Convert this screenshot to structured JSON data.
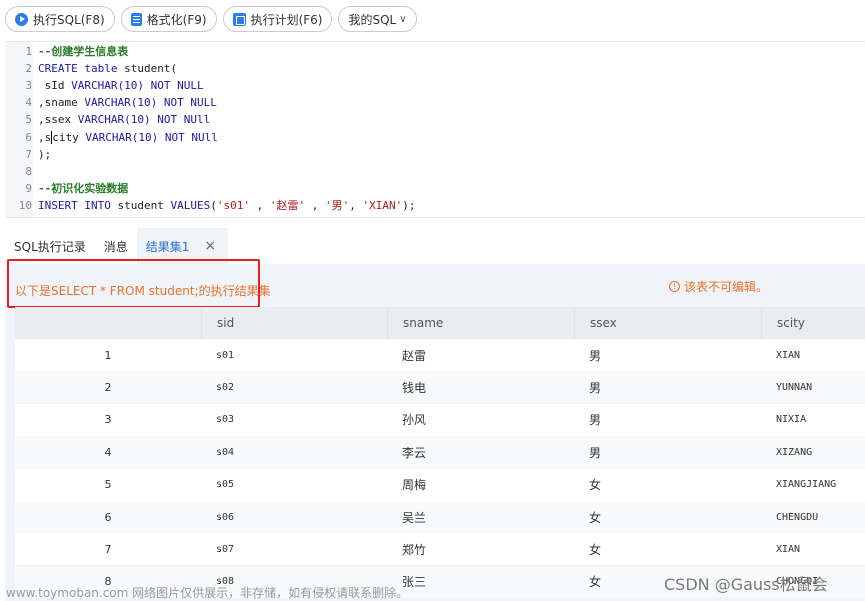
{
  "toolbar": {
    "buttons": [
      {
        "label": "执行SQL(F8)",
        "icon": "play-icon"
      },
      {
        "label": "格式化(F9)",
        "icon": "format-icon"
      },
      {
        "label": "执行计划(F6)",
        "icon": "plan-icon"
      },
      {
        "label": "我的SQL",
        "icon": "chevron-down-icon"
      }
    ]
  },
  "editor": {
    "lines": [
      {
        "n": "1",
        "parts": [
          {
            "t": "--创建学生信息表",
            "c": "cm"
          }
        ]
      },
      {
        "n": "2",
        "parts": [
          {
            "t": "CREATE table",
            "c": "kw"
          },
          {
            "t": " student(",
            "c": "tx"
          }
        ]
      },
      {
        "n": "3",
        "parts": [
          {
            "t": " sId ",
            "c": "tx"
          },
          {
            "t": "VARCHAR(10) NOT NULL",
            "c": "kw"
          }
        ]
      },
      {
        "n": "4",
        "parts": [
          {
            "t": ",sname ",
            "c": "tx"
          },
          {
            "t": "VARCHAR(10) NOT NULL",
            "c": "kw"
          }
        ]
      },
      {
        "n": "5",
        "parts": [
          {
            "t": ",ssex ",
            "c": "tx"
          },
          {
            "t": "VARCHAR(10) NOT NUll",
            "c": "kw"
          }
        ]
      },
      {
        "n": "6",
        "parts": [
          {
            "t": ",s",
            "c": "tx"
          },
          {
            "t": "|",
            "c": "cursor"
          },
          {
            "t": "city ",
            "c": "tx"
          },
          {
            "t": "VARCHAR(10) NOT NUll",
            "c": "kw"
          }
        ]
      },
      {
        "n": "7",
        "parts": [
          {
            "t": ");",
            "c": "tx"
          }
        ]
      },
      {
        "n": "8",
        "parts": []
      },
      {
        "n": "9",
        "parts": [
          {
            "t": "--初识化实验数据",
            "c": "cm"
          }
        ]
      },
      {
        "n": "10",
        "parts": [
          {
            "t": "INSERT INTO",
            "c": "kw"
          },
          {
            "t": " student ",
            "c": "tx"
          },
          {
            "t": "VALUES",
            "c": "kw"
          },
          {
            "t": "(",
            "c": "tx"
          },
          {
            "t": "'s01'",
            "c": "st"
          },
          {
            "t": " , ",
            "c": "tx"
          },
          {
            "t": "'赵雷'",
            "c": "st"
          },
          {
            "t": " , ",
            "c": "tx"
          },
          {
            "t": "'男'",
            "c": "st"
          },
          {
            "t": ", ",
            "c": "tx"
          },
          {
            "t": "'XIAN'",
            "c": "st"
          },
          {
            "t": ");",
            "c": "tx"
          }
        ]
      }
    ]
  },
  "tabs": [
    {
      "label": "SQL执行记录",
      "active": false
    },
    {
      "label": "消息",
      "active": false
    },
    {
      "label": "结果集1",
      "active": true,
      "close": "×"
    }
  ],
  "result": {
    "hint": "以下是SELECT * FROM student;的执行结果集",
    "warning": "该表不可编辑。",
    "columns": [
      "",
      "sid",
      "sname",
      "ssex",
      "scity"
    ],
    "rows": [
      [
        "1",
        "s01",
        "赵雷",
        "男",
        "XIAN"
      ],
      [
        "2",
        "s02",
        "钱电",
        "男",
        "YUNNAN"
      ],
      [
        "3",
        "s03",
        "孙风",
        "男",
        "NIXIA"
      ],
      [
        "4",
        "s04",
        "李云",
        "男",
        "XIZANG"
      ],
      [
        "5",
        "s05",
        "周梅",
        "女",
        "XIANGJIANG"
      ],
      [
        "6",
        "s06",
        "吴兰",
        "女",
        "CHENGDU"
      ],
      [
        "7",
        "s07",
        "郑竹",
        "女",
        "XIAN"
      ],
      [
        "8",
        "s08",
        "张三",
        "女",
        "CHONGQI"
      ]
    ]
  },
  "watermarks": {
    "left": "www.toymoban.com 网络图片仅供展示，非存储，如有侵权请联系删除。",
    "right": "CSDN @Gauss松鼠会"
  },
  "colors": {
    "accent": "#2b7de9",
    "hint_orange": "#e8722a",
    "highlight_red": "#e02424"
  }
}
